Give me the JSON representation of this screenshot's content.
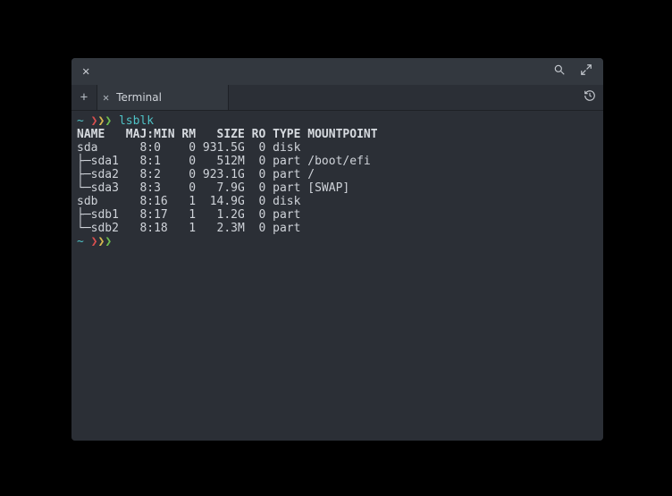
{
  "tab": {
    "label": "Terminal"
  },
  "prompt": {
    "tilde": "~",
    "a1": "❯",
    "a2": "❯",
    "a3": "❯"
  },
  "command": "lsblk",
  "header": "NAME   MAJ:MIN RM   SIZE RO TYPE MOUNTPOINT",
  "rows": [
    "sda      8:0    0 931.5G  0 disk ",
    "├─sda1   8:1    0   512M  0 part /boot/efi",
    "├─sda2   8:2    0 923.1G  0 part /",
    "└─sda3   8:3    0   7.9G  0 part [SWAP]",
    "sdb      8:16   1  14.9G  0 disk ",
    "├─sdb1   8:17   1   1.2G  0 part ",
    "└─sdb2   8:18   1   2.3M  0 part "
  ]
}
